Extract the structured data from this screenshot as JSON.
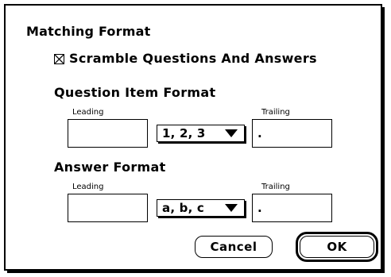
{
  "dialog": {
    "title": "Matching Format",
    "scramble": {
      "label": "Scramble Questions And Answers",
      "checked": true
    },
    "question_format": {
      "heading": "Question Item Format",
      "leading_label": "Leading",
      "leading_value": "",
      "numbering_value": "1, 2, 3",
      "trailing_label": "Trailing",
      "trailing_value": "."
    },
    "answer_format": {
      "heading": "Answer Format",
      "leading_label": "Leading",
      "leading_value": "",
      "numbering_value": "a, b, c",
      "trailing_label": "Trailing",
      "trailing_value": "."
    },
    "buttons": {
      "cancel_label": "Cancel",
      "ok_label": "OK"
    }
  }
}
